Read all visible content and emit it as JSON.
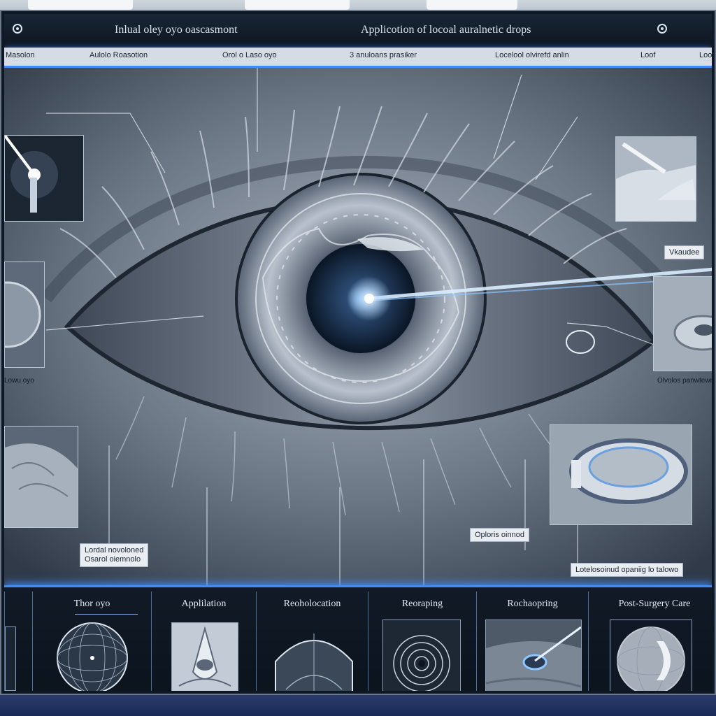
{
  "window": {
    "title_left": "Inlual oley oyo oascasmont",
    "title_right": "Applicotion of locoal auralnetic drops"
  },
  "label_row": [
    "Masolon",
    "Aulolo Roasotion",
    "Orol o Laso oyo",
    "3 anuloans prasiker",
    "Locelool olvirefd anlin",
    "Loof",
    "Loo"
  ],
  "callouts": {
    "right_tag": "Vkaudee",
    "left_small": "Lowu oyo",
    "right_small": "Olvolos panwtewnon",
    "lower_left_tag_line1": "Lordal novoloned",
    "lower_left_tag_line2": "Osarol oiemnolo",
    "ophoris_tag": "Oploris oinnod",
    "lower_right_tag": "Lotelosoinud opaniig lo talowo"
  },
  "steps": [
    {
      "label": "Thor oyo",
      "icon": "sphere-grid-icon"
    },
    {
      "label": "Applilation",
      "icon": "eyelid-applicator-icon"
    },
    {
      "label": "Reoholocation",
      "icon": "cornea-dome-icon"
    },
    {
      "label": "Reoraping",
      "icon": "concentric-rings-icon"
    },
    {
      "label": "Rochaopring",
      "icon": "laser-eye-icon"
    },
    {
      "label": "Post-Surgery Care",
      "icon": "contact-lens-icon"
    }
  ],
  "colors": {
    "accent": "#3f8cff",
    "laser": "#cfe6ff",
    "iris": "#8e98a6"
  }
}
